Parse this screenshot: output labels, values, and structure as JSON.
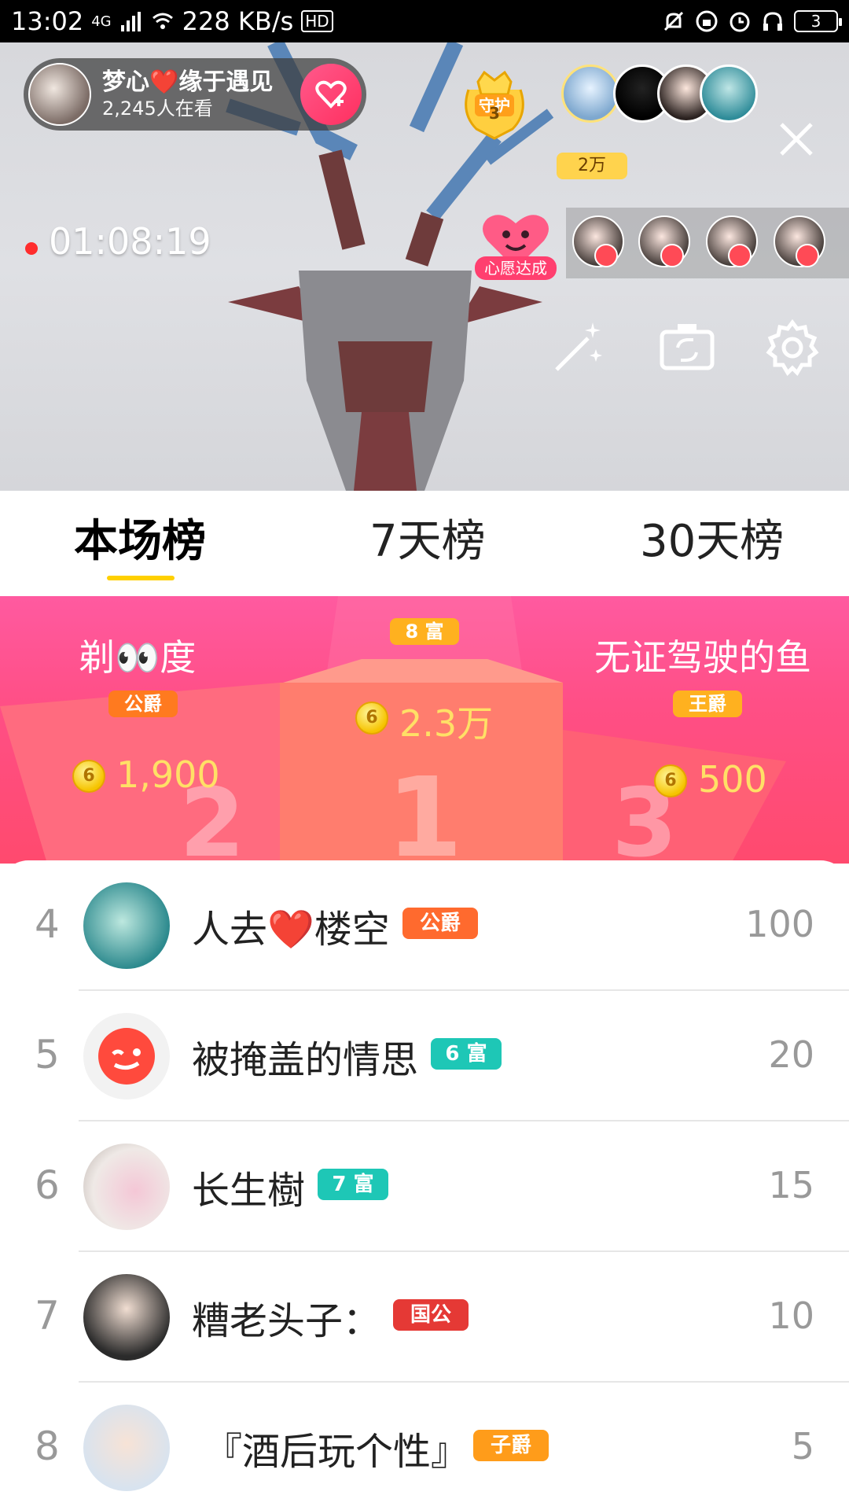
{
  "status_bar": {
    "time": "13:02",
    "network": "4G",
    "speed": "228 KB/s",
    "hd": "HD",
    "battery": "3"
  },
  "live": {
    "host_name": "梦心❤️缘于遇见",
    "viewers": "2,245人在看",
    "guard_label": "守护",
    "guard_count": "3",
    "contribution": "2万",
    "timer": "01:08:19",
    "wish_label": "心愿达成"
  },
  "tabs": [
    {
      "label": "本场榜",
      "active": true
    },
    {
      "label": "7天榜",
      "active": false
    },
    {
      "label": "30天榜",
      "active": false
    }
  ],
  "podium": {
    "first": {
      "badge": "8 富",
      "coin": "6",
      "value": "2.3万"
    },
    "second": {
      "name": "剃👀度",
      "badge": "公爵",
      "coin": "6",
      "value": "1,900"
    },
    "third": {
      "name": "无证驾驶的鱼",
      "badge": "王爵",
      "coin": "6",
      "value": "500"
    }
  },
  "ranking": [
    {
      "rank": "4",
      "name": "人去❤️楼空",
      "badge": "公爵",
      "badge_color": "#ff6a2e",
      "score": "100"
    },
    {
      "rank": "5",
      "name": "被掩盖的情思",
      "badge": "6 富",
      "badge_color": "#1ec7b6",
      "score": "20"
    },
    {
      "rank": "6",
      "name": "长生樹",
      "badge": "7 富",
      "badge_color": "#1ec7b6",
      "score": "15"
    },
    {
      "rank": "7",
      "name": "糟老头子：",
      "badge": "国公",
      "badge_color": "#e53935",
      "score": "10"
    },
    {
      "rank": "8",
      "name": "『酒后玩个性』",
      "badge": "子爵",
      "badge_color": "#ff9c1a",
      "score": "5"
    }
  ],
  "colors": {
    "podium_pink": "#ff4f86",
    "tab_underline": "#ffd000",
    "coin_gold": "#f6c400",
    "value_yellow": "#ffe066"
  }
}
